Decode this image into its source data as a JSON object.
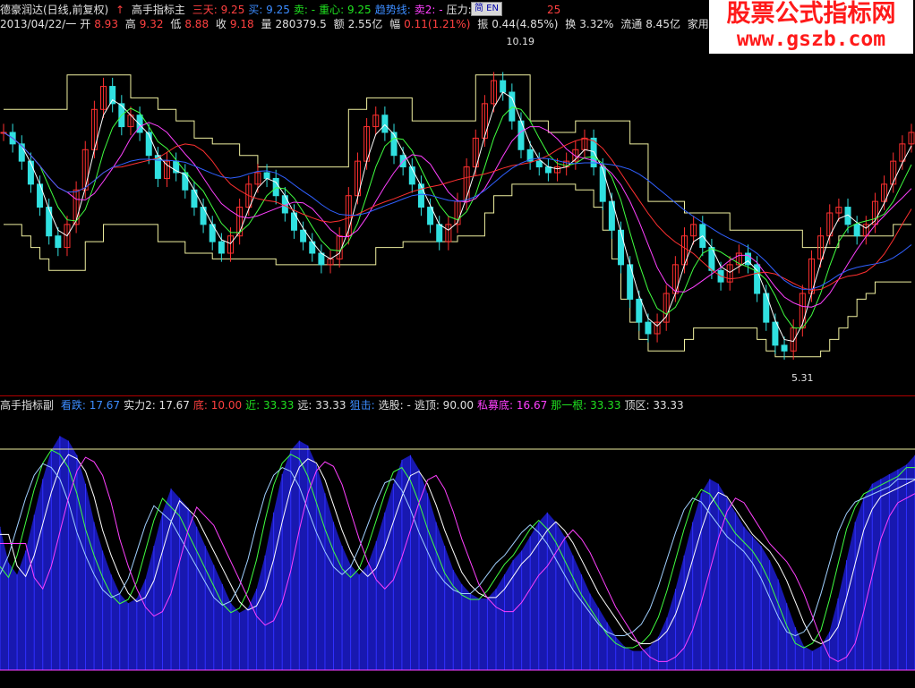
{
  "header": {
    "title": "德豪润达(日线,前复权)",
    "indicator_main": "高手指标主",
    "fields": [
      {
        "label": "三天",
        "value": "9.25",
        "color": "#ff4040"
      },
      {
        "label": "买",
        "value": "9.25",
        "color": "#3c8cff"
      },
      {
        "label": "卖",
        "value": "-",
        "color": "#20e020"
      },
      {
        "label": "重心",
        "value": "9.25",
        "color": "#20e020"
      },
      {
        "label": "趋势线",
        "value": "",
        "color": "#3c8cff"
      },
      {
        "label": "卖2",
        "value": "-",
        "color": "#ff40ff"
      },
      {
        "label": "压力",
        "value": "",
        "color": "#e0e0e0"
      }
    ],
    "tail_value": "25"
  },
  "quote": {
    "date": "2013/04/22/一",
    "open_label": "开",
    "open": "8.93",
    "high_label": "高",
    "high": "9.32",
    "low_label": "低",
    "low": "8.88",
    "close_label": "收",
    "close": "9.18",
    "vol_label": "量",
    "vol": "280379.5",
    "amount_label": "额",
    "amount": "2.55亿",
    "change_label": "幅",
    "change": "0.11(1.21%)",
    "amplitude_label": "振",
    "amplitude": "0.44(4.85%)",
    "turnover_label": "换",
    "turnover": "3.32%",
    "float_label": "流通",
    "float": "8.45亿",
    "sector": "家用电器"
  },
  "toolbar": {
    "lang": "简 EN"
  },
  "sub_header": {
    "title": "高手指标副",
    "fields": [
      {
        "label": "看跌",
        "value": "17.67",
        "color": "#3c8cff"
      },
      {
        "label": "实力2",
        "value": "17.67",
        "color": "#e0e0e0"
      },
      {
        "label": "底",
        "value": "10.00",
        "color": "#ff4040"
      },
      {
        "label": "近",
        "value": "33.33",
        "color": "#20e020"
      },
      {
        "label": "远",
        "value": "33.33",
        "color": "#e0e0e0"
      },
      {
        "label": "狙击",
        "value": "",
        "color": "#3c8cff"
      },
      {
        "label": "选股",
        "value": "-",
        "color": "#e0e0e0"
      },
      {
        "label": "逃顶",
        "value": "90.00",
        "color": "#e0e0e0"
      },
      {
        "label": "私募底",
        "value": "16.67",
        "color": "#ff40ff"
      },
      {
        "label": "那一根",
        "value": "33.33",
        "color": "#20e020"
      },
      {
        "label": "顶区",
        "value": "33.33",
        "color": "#e0e0e0"
      }
    ]
  },
  "watermark": {
    "title": "股票公式指标网",
    "url": "www.gszb.com"
  },
  "chart_data": [
    {
      "type": "line",
      "title": "高手指标主",
      "annotations": [
        {
          "text": "10.19"
        },
        {
          "text": "5.31"
        }
      ],
      "close": [
        9.2,
        9.0,
        8.7,
        8.3,
        7.9,
        7.4,
        7.2,
        7.6,
        8.2,
        8.9,
        9.6,
        10.0,
        9.7,
        9.3,
        9.5,
        9.2,
        8.8,
        8.4,
        8.7,
        8.5,
        8.2,
        7.9,
        7.6,
        7.3,
        7.1,
        7.4,
        7.9,
        8.3,
        8.5,
        8.4,
        8.1,
        7.8,
        7.5,
        7.3,
        7.1,
        6.9,
        7.0,
        7.4,
        8.1,
        8.7,
        9.3,
        9.5,
        9.2,
        8.8,
        8.6,
        8.3,
        7.9,
        7.6,
        7.3,
        7.6,
        8.0,
        8.6,
        9.1,
        9.7,
        10.1,
        9.9,
        9.4,
        8.9,
        8.7,
        8.6,
        8.5,
        8.6,
        8.7,
        8.9,
        9.1,
        8.6,
        8.0,
        7.5,
        6.9,
        6.3,
        5.9,
        5.7,
        5.9,
        6.4,
        6.9,
        7.4,
        7.6,
        7.2,
        6.8,
        6.6,
        6.9,
        7.1,
        6.9,
        6.4,
        5.9,
        5.5,
        5.4,
        5.8,
        6.4,
        7.0,
        7.4,
        7.8,
        7.9,
        7.6,
        7.4,
        7.6,
        8.0,
        8.3,
        8.7,
        9.0,
        9.2
      ],
      "upper": [
        9.6,
        9.6,
        9.6,
        9.6,
        9.6,
        9.6,
        9.6,
        10.2,
        10.2,
        10.2,
        10.2,
        10.2,
        10.2,
        10.2,
        9.8,
        9.8,
        9.8,
        9.6,
        9.6,
        9.4,
        9.4,
        9.1,
        9.1,
        9.0,
        9.0,
        9.0,
        8.8,
        8.8,
        8.6,
        8.6,
        8.6,
        8.6,
        8.6,
        8.6,
        8.6,
        8.6,
        8.6,
        8.6,
        9.6,
        9.6,
        9.8,
        9.8,
        9.8,
        9.8,
        9.8,
        9.4,
        9.4,
        9.4,
        9.4,
        9.4,
        9.4,
        9.4,
        10.2,
        10.2,
        10.2,
        10.2,
        10.2,
        10.2,
        9.4,
        9.4,
        9.2,
        9.2,
        9.2,
        9.4,
        9.4,
        9.4,
        9.4,
        9.4,
        9.4,
        9.0,
        9.0,
        8.0,
        8.0,
        8.0,
        8.0,
        7.8,
        7.8,
        7.8,
        7.8,
        7.8,
        7.5,
        7.5,
        7.5,
        7.5,
        7.5,
        7.5,
        7.5,
        7.5,
        7.2,
        7.2,
        7.2,
        7.2,
        7.4,
        7.4,
        7.4,
        7.4,
        7.4,
        7.4,
        7.6,
        7.6,
        7.6
      ],
      "lower": [
        7.6,
        7.6,
        7.4,
        7.2,
        7.0,
        6.8,
        6.8,
        6.8,
        6.8,
        7.3,
        7.3,
        7.6,
        7.6,
        7.6,
        7.6,
        7.6,
        7.6,
        7.3,
        7.3,
        7.3,
        7.1,
        7.1,
        7.1,
        7.0,
        7.0,
        7.0,
        7.0,
        7.0,
        7.0,
        7.0,
        6.9,
        6.9,
        6.9,
        6.9,
        6.9,
        6.9,
        6.9,
        6.9,
        6.9,
        6.9,
        6.9,
        7.2,
        7.2,
        7.2,
        7.3,
        7.3,
        7.3,
        7.3,
        7.3,
        7.3,
        7.4,
        7.4,
        7.4,
        7.8,
        8.1,
        8.1,
        8.3,
        8.3,
        8.3,
        8.3,
        8.3,
        8.3,
        8.3,
        8.2,
        8.2,
        7.9,
        7.5,
        7.0,
        6.3,
        5.9,
        5.6,
        5.4,
        5.4,
        5.4,
        5.4,
        5.6,
        5.8,
        5.8,
        5.8,
        5.8,
        5.8,
        5.8,
        5.8,
        5.6,
        5.4,
        5.3,
        5.3,
        5.3,
        5.3,
        5.3,
        5.4,
        5.6,
        5.8,
        6.0,
        6.3,
        6.4,
        6.6,
        6.6,
        6.6,
        6.6,
        6.6
      ]
    },
    {
      "type": "area",
      "title": "高手指标副",
      "ylim": [
        0,
        100
      ],
      "values": [
        60,
        45,
        40,
        50,
        65,
        80,
        92,
        98,
        96,
        90,
        78,
        62,
        50,
        40,
        32,
        28,
        30,
        38,
        52,
        66,
        76,
        72,
        68,
        60,
        52,
        44,
        36,
        28,
        24,
        26,
        34,
        48,
        66,
        82,
        92,
        96,
        94,
        86,
        74,
        62,
        52,
        44,
        40,
        44,
        54,
        66,
        78,
        88,
        90,
        84,
        74,
        62,
        52,
        42,
        36,
        32,
        30,
        30,
        34,
        40,
        46,
        50,
        56,
        62,
        66,
        62,
        56,
        48,
        40,
        32,
        26,
        20,
        14,
        10,
        8,
        8,
        10,
        14,
        22,
        34,
        48,
        62,
        74,
        80,
        78,
        72,
        66,
        60,
        56,
        52,
        46,
        38,
        28,
        18,
        10,
        8,
        10,
        16,
        30,
        46,
        62,
        72,
        78,
        80,
        82,
        84,
        86,
        90
      ]
    }
  ]
}
